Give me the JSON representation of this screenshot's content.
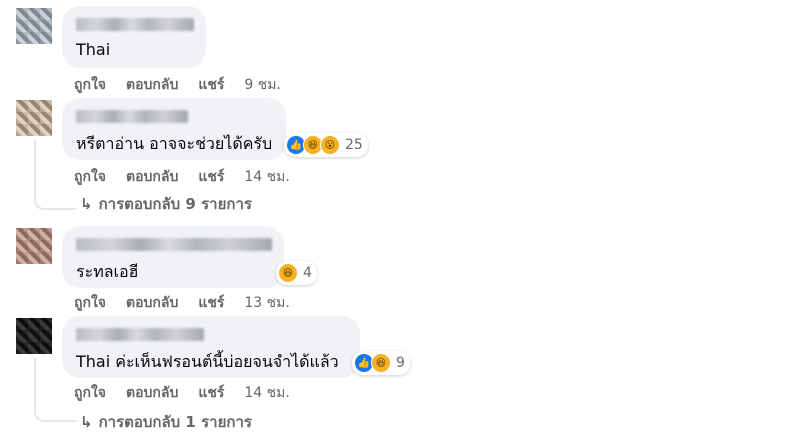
{
  "comments": [
    {
      "text": "Thai",
      "actions": {
        "like": "ถูกใจ",
        "reply": "ตอบกลับ",
        "share": "แชร์",
        "time": "9 ชม."
      }
    },
    {
      "text": "หรีตาอ่าน อาจจะช่วยได้ครับ",
      "reactions": {
        "icons": [
          "like-icon",
          "haha-icon",
          "wow-icon"
        ],
        "count": "25"
      },
      "actions": {
        "like": "ถูกใจ",
        "reply": "ตอบกลับ",
        "share": "แชร์",
        "time": "14 ชม."
      },
      "replies": "การตอบกลับ 9 รายการ"
    },
    {
      "text": "ระทลเอฮี",
      "reactions": {
        "icons": [
          "haha-icon"
        ],
        "count": "4"
      },
      "actions": {
        "like": "ถูกใจ",
        "reply": "ตอบกลับ",
        "share": "แชร์",
        "time": "13 ชม."
      }
    },
    {
      "text": "Thai ค่ะเห็นฟรอนต์นี้บ่อยจนจำได้แล้ว",
      "reactions": {
        "icons": [
          "like-icon",
          "haha-icon"
        ],
        "count": "9"
      },
      "actions": {
        "like": "ถูกใจ",
        "reply": "ตอบกลับ",
        "share": "แชร์",
        "time": "14 ชม."
      },
      "replies": "การตอบกลับ 1 รายการ"
    }
  ],
  "colors": {
    "bubble": "#f0f2f5",
    "meta": "#65676b",
    "like": "#1877f2",
    "haha": "#f7b125"
  }
}
